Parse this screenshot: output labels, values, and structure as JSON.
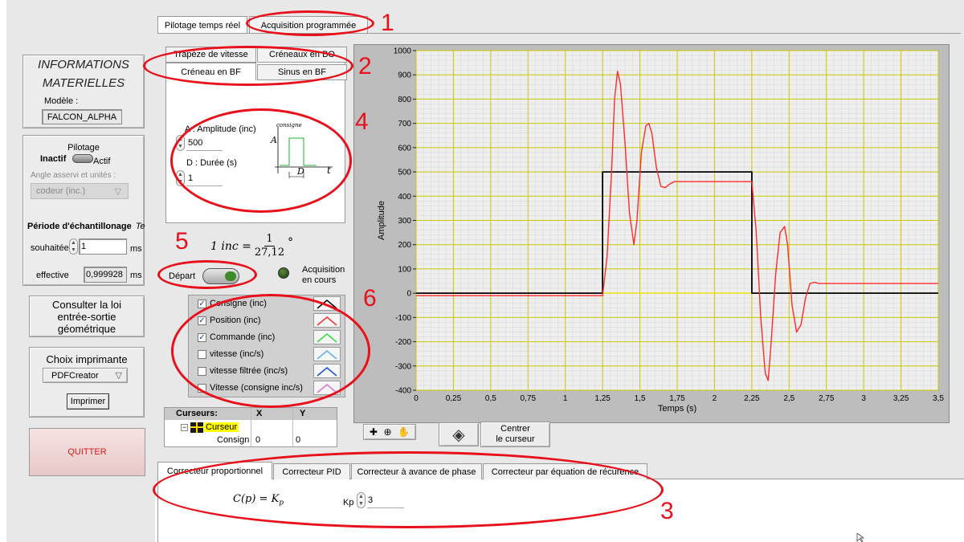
{
  "main_tabs": [
    {
      "label": "Pilotage temps réel",
      "active": true
    },
    {
      "label": "Acquisition programmée",
      "active": false
    }
  ],
  "info": {
    "title_line1": "INFORMATIONS",
    "title_line2": "MATERIELLES",
    "model_label": "Modèle :",
    "model_value": "FALCON_ALPHA"
  },
  "pilotage": {
    "title": "Pilotage",
    "inactive_label": "Inactif",
    "active_label": "Actif",
    "angle_label": "Angle asservi et unités :",
    "angle_value": "codeur (inc.)",
    "period_label": "Période d'échantillonage",
    "period_symbol": "Te",
    "desired_label": "souhaitée",
    "desired_value": "1",
    "desired_unit": "ms",
    "effective_label": "effective",
    "effective_value": "0,999928",
    "effective_unit": "ms"
  },
  "law_button": {
    "line1": "Consulter la loi",
    "line2": "entrée-sortie",
    "line3": "géométrique"
  },
  "printer": {
    "title": "Choix imprimante",
    "value": "PDFCreator",
    "print_label": "Imprimer"
  },
  "quit_label": "QUITTER",
  "signal_tabs": [
    {
      "label": "Trapèze de vitesse"
    },
    {
      "label": "Créneaux en BO"
    },
    {
      "label": "Créneau en BF",
      "active": true
    },
    {
      "label": "Sinus en BF"
    }
  ],
  "signal": {
    "amplitude_label": "A : Amplitude (inc)",
    "amplitude_value": "500",
    "duration_label": "D : Durée (s)",
    "duration_value": "1",
    "sketch_caption": "consigne",
    "sketch_a": "A",
    "sketch_d": "D",
    "sketch_t": "t"
  },
  "formula": {
    "lhs": "1 inc =",
    "num": "1",
    "den": "27,12",
    "unit": "°"
  },
  "depart": {
    "label": "Départ",
    "acq_line1": "Acquisition",
    "acq_line2": "en cours"
  },
  "legend": [
    {
      "label": "Consigne (inc)",
      "checked": true,
      "color": "#000000"
    },
    {
      "label": "Position (inc)",
      "checked": true,
      "color": "#ff3030"
    },
    {
      "label": "Commande (inc)",
      "checked": true,
      "color": "#30e040"
    },
    {
      "label": "vitesse (inc/s)",
      "checked": false,
      "color": "#60b0ff"
    },
    {
      "label": "vitesse filtrée (inc/s)",
      "checked": false,
      "color": "#2050d0"
    },
    {
      "label": "Vitesse (consigne inc/s)",
      "checked": false,
      "color": "#e070e0"
    }
  ],
  "cursors": {
    "header_name": "Curseurs:",
    "header_x": "X",
    "header_y": "Y",
    "cursor_name": "Curseur",
    "row_label": "Consign",
    "row_x": "0",
    "row_y": "0"
  },
  "center_button": {
    "line1": "Centrer",
    "line2": "le curseur"
  },
  "correctors": [
    {
      "label": "Correcteur proportionnel",
      "active": true
    },
    {
      "label": "Correcteur PID"
    },
    {
      "label": "Correcteur à avance de phase"
    },
    {
      "label": "Correcteur par équation de récurence"
    }
  ],
  "corrector": {
    "formula_lhs": "C(p) = K",
    "formula_sub": "p",
    "kp_label": "Kp",
    "kp_value": "3"
  },
  "annotations": [
    "1",
    "2",
    "3",
    "4",
    "5",
    "6"
  ],
  "chart_data": {
    "type": "line",
    "title": "",
    "xlabel": "Temps (s)",
    "ylabel": "Amplitude",
    "xlim": [
      0,
      3.5
    ],
    "ylim": [
      -400,
      1000
    ],
    "xticks": [
      "0",
      "0,25",
      "0,5",
      "0,75",
      "1",
      "1,25",
      "1,5",
      "1,75",
      "2",
      "2,25",
      "2,5",
      "2,75",
      "3",
      "3,25",
      "3,5"
    ],
    "yticks": [
      "-400",
      "-300",
      "-200",
      "-100",
      "0",
      "100",
      "200",
      "300",
      "400",
      "500",
      "600",
      "700",
      "800",
      "900",
      "1000"
    ],
    "grid": true,
    "series": [
      {
        "color": "#000000",
        "x": [
          0,
          1.25,
          1.25,
          2.25,
          2.25,
          3.5
        ],
        "y": [
          0,
          0,
          500,
          500,
          0,
          0
        ]
      },
      {
        "color": "#ff2a2a",
        "x": [
          0,
          1.25,
          1.28,
          1.31,
          1.33,
          1.35,
          1.37,
          1.4,
          1.43,
          1.46,
          1.48,
          1.51,
          1.54,
          1.56,
          1.58,
          1.61,
          1.64,
          1.67,
          1.7,
          1.73,
          1.78,
          2.25,
          2.28,
          2.31,
          2.34,
          2.36,
          2.38,
          2.41,
          2.44,
          2.47,
          2.49,
          2.52,
          2.55,
          2.58,
          2.61,
          2.64,
          2.67,
          2.7,
          2.75,
          3.5
        ],
        "y": [
          -10,
          -10,
          150,
          500,
          800,
          915,
          860,
          620,
          330,
          200,
          300,
          580,
          690,
          700,
          660,
          520,
          440,
          435,
          450,
          460,
          460,
          460,
          250,
          -100,
          -330,
          -360,
          -200,
          80,
          250,
          275,
          200,
          -50,
          -160,
          -130,
          -20,
          40,
          45,
          40,
          40,
          40
        ]
      },
      {
        "color": "#f0e000",
        "x": [
          0,
          3.5
        ],
        "y": [
          0,
          0
        ]
      }
    ]
  }
}
